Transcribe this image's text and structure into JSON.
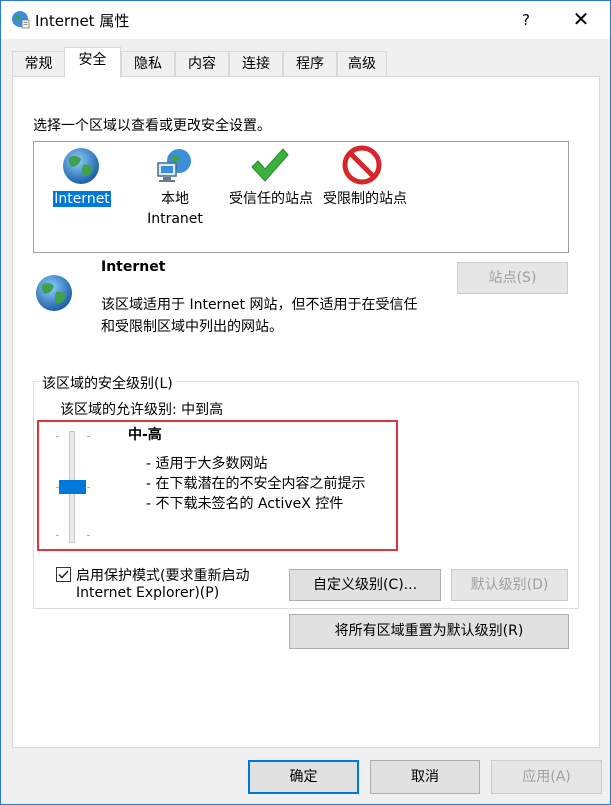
{
  "window": {
    "title": "Internet 属性",
    "help": "?",
    "close": "✕"
  },
  "tabs": [
    {
      "label": "常规"
    },
    {
      "label": "安全",
      "active": true
    },
    {
      "label": "隐私"
    },
    {
      "label": "内容"
    },
    {
      "label": "连接"
    },
    {
      "label": "程序"
    },
    {
      "label": "高级"
    }
  ],
  "security": {
    "instruction": "选择一个区域以查看或更改安全设置。",
    "zones": [
      {
        "label": "Internet",
        "icon": "globe-icon",
        "selected": true
      },
      {
        "label_line1": "本地",
        "label_line2": "Intranet",
        "icon": "intranet-icon"
      },
      {
        "label": "受信任的站点",
        "icon": "checkmark-icon"
      },
      {
        "label": "受限制的站点",
        "icon": "restricted-icon"
      }
    ],
    "zone_title": "Internet",
    "zone_desc_line1": "该区域适用于 Internet 网站，但不适用于在受信任",
    "zone_desc_line2": "和受限制区域中列出的网站。",
    "sites_button": "站点(S)",
    "level_group_title": "该区域的安全级别(L)",
    "allowed_levels": "该区域的允许级别: 中到高",
    "level_name": "中-高",
    "level_bullets": [
      "- 适用于大多数网站",
      "- 在下载潜在的不安全内容之前提示",
      "- 不下载未签名的 ActiveX 控件"
    ],
    "slider_level_index": 2,
    "slider_levels_count": 3,
    "protected_mode_line1": "启用保护模式(要求重新启动",
    "protected_mode_line2": "Internet Explorer)(P)",
    "protected_mode_checked": true,
    "custom_level_button": "自定义级别(C)...",
    "default_level_button": "默认级别(D)",
    "reset_all_button": "将所有区域重置为默认级别(R)"
  },
  "footer": {
    "ok": "确定",
    "cancel": "取消",
    "apply": "应用(A)"
  },
  "colors": {
    "accent": "#0078d7",
    "highlight_box": "#d9383c",
    "globe": "#2a7ec7",
    "trusted": "#3db13d",
    "restricted": "#d7262b"
  }
}
